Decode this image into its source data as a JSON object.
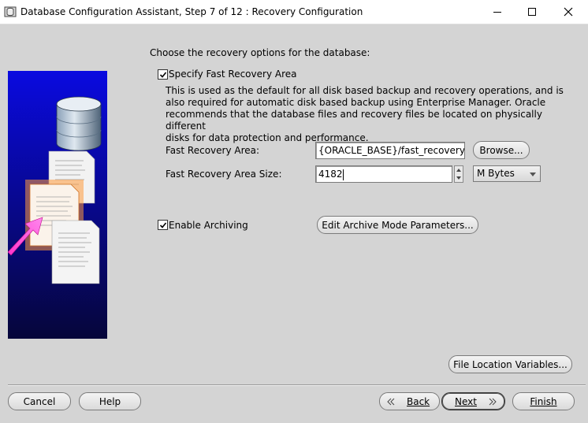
{
  "window": {
    "title": "Database Configuration Assistant, Step 7 of 12 : Recovery Configuration"
  },
  "instruction": "Choose the recovery options for the database:",
  "fast_recovery": {
    "checkbox_label": "Specify Fast Recovery Area",
    "checked": true,
    "description_lines": [
      "This is used as the default for all disk based backup and recovery operations, and is",
      "also required for automatic disk based backup using Enterprise Manager. Oracle",
      "recommends that the database files and recovery files be located on physically different",
      "disks for data protection and performance."
    ],
    "area_label": "Fast Recovery Area:",
    "area_value": "{ORACLE_BASE}/fast_recovery_a",
    "browse_label": "Browse...",
    "size_label": "Fast Recovery Area Size:",
    "size_value": "4182",
    "size_unit": "M Bytes"
  },
  "archiving": {
    "checkbox_label": "Enable Archiving",
    "checked": true,
    "edit_params_label": "Edit Archive Mode Parameters..."
  },
  "file_location_label": "File Location Variables...",
  "footer": {
    "cancel": "Cancel",
    "help": "Help",
    "back": "Back",
    "next": "Next",
    "finish": "Finish"
  }
}
